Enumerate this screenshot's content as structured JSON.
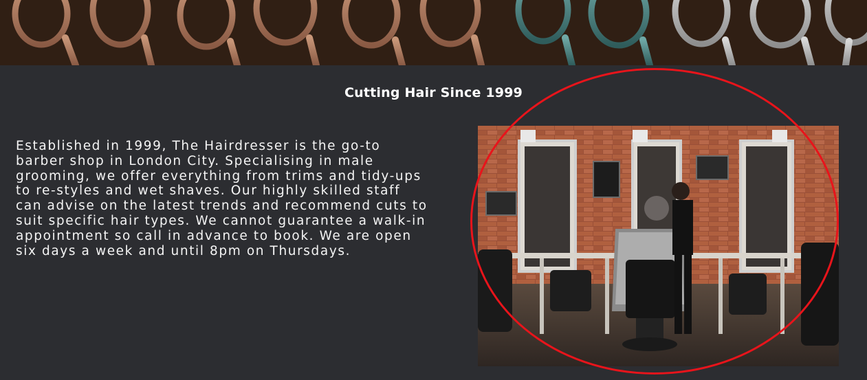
{
  "section": {
    "heading": "Cutting Hair Since 1999",
    "body": "Established in 1999, The Hairdresser is the go-to barber shop in London City. Specialising in male grooming, we offer everything from trims and tidy-ups to re-styles and wet shaves. Our highly skilled staff can advise on the latest trends and recommend cuts to suit specific hair types. We cannot guarantee a walk-in appointment so call in advance to book. We are open six days a week and until 8pm on Thursdays."
  },
  "colors": {
    "background": "#2c2d31",
    "heading": "#ffffff",
    "text": "#f4f4f4",
    "annotation_circle": "#e8141b"
  }
}
